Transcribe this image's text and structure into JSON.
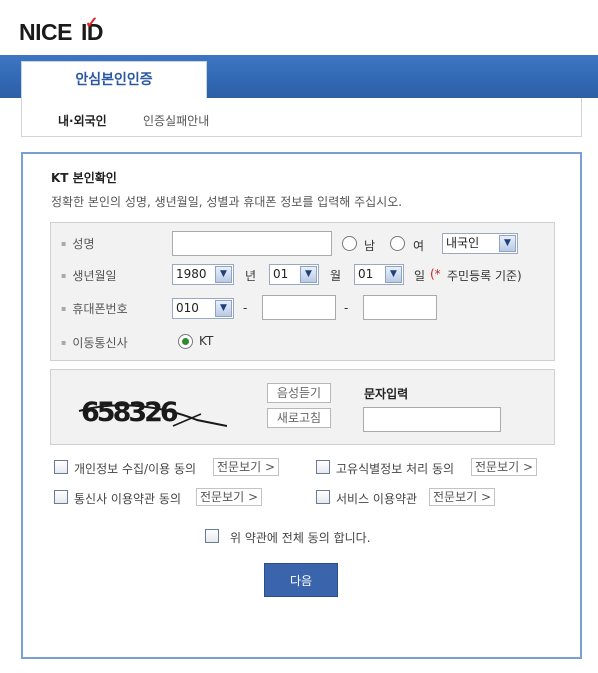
{
  "brand": {
    "logo_text": "NICE",
    "logo_text2": "ID",
    "logo_mark": "✓"
  },
  "tabs": {
    "active": "안심본인인증"
  },
  "subnav": {
    "item1": "내·외국인",
    "item2": "인증실패안내"
  },
  "form": {
    "title": "KT 본인확인",
    "description": "정확한 본인의 성명, 생년월일, 성별과 휴대폰 정보를 입력해 주십시오.",
    "name_label": "성명",
    "name_value": "",
    "gender_male": "남",
    "gender_female": "여",
    "nationality_selected": "내국인",
    "birth_label": "생년월일",
    "birth_year": "1980",
    "year_unit": "년",
    "birth_month": "01",
    "month_unit": "월",
    "birth_day": "01",
    "day_unit": "일",
    "birth_note_star": "(*",
    "birth_note": "주민등록 기준)",
    "phone_label": "휴대폰번호",
    "phone_prefix": "010",
    "dash": "-",
    "phone_mid": "",
    "phone_last": "",
    "carrier_label": "이동통신사",
    "carrier_value": "KT"
  },
  "captcha": {
    "code": "658326",
    "listen_button": "음성듣기",
    "refresh_button": "새로고침",
    "input_label": "문자입력",
    "input_value": ""
  },
  "agreements": {
    "a1": "개인정보 수집/이용 동의",
    "a2": "고유식별정보 처리 동의",
    "a3": "통신사 이용약관 동의",
    "a4": "서비스 이용약관",
    "view_button": "전문보기 >",
    "all": "위 약관에 전체 동의 합니다."
  },
  "actions": {
    "next": "다음"
  },
  "colors": {
    "primary": "#2b5fa6",
    "logo_red": "#e3252b",
    "border": "#7aa0d3"
  }
}
